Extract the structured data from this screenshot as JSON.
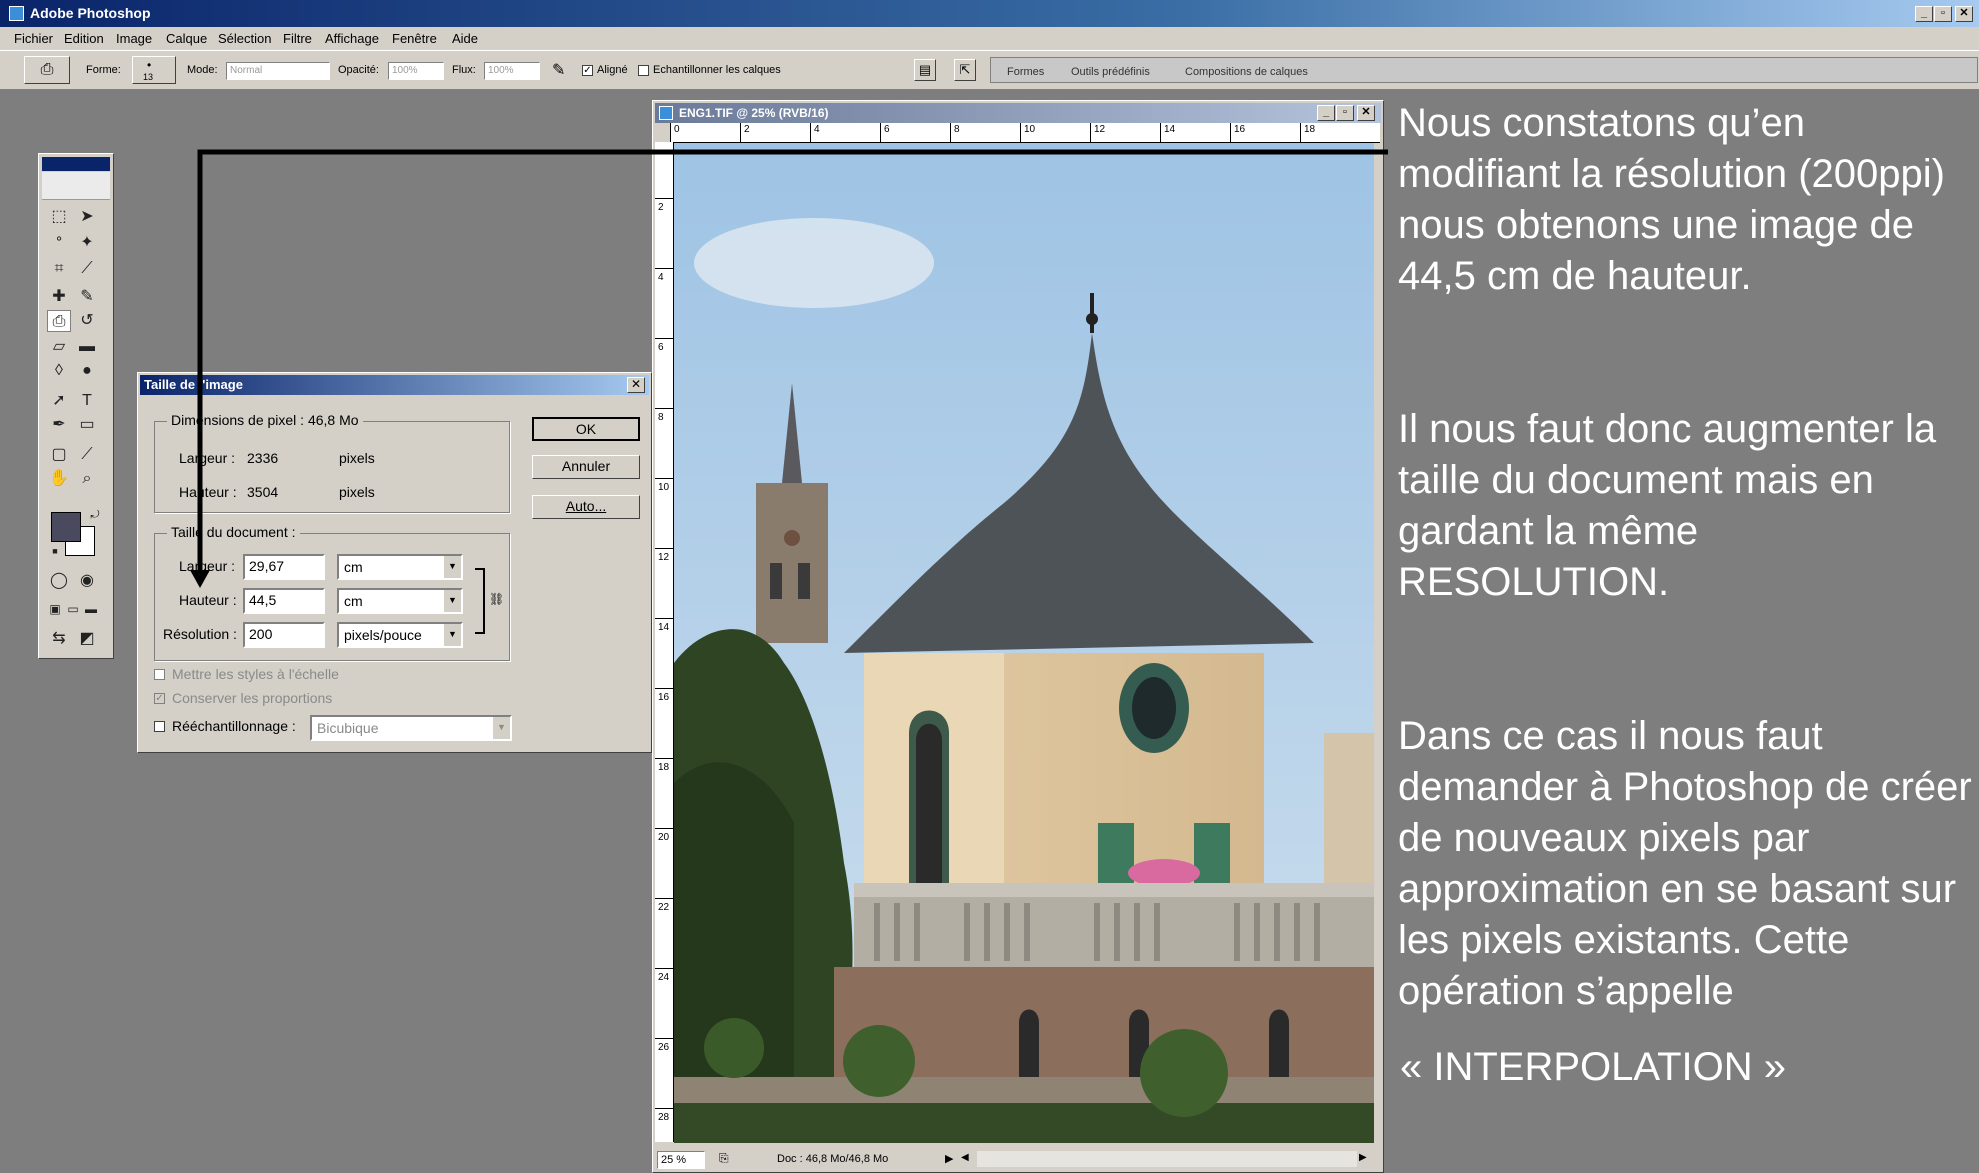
{
  "app": {
    "title": "Adobe Photoshop"
  },
  "menu": {
    "items": [
      "Fichier",
      "Edition",
      "Image",
      "Calque",
      "Sélection",
      "Filtre",
      "Affichage",
      "Fenêtre",
      "Aide"
    ]
  },
  "options": {
    "forme_label": "Forme:",
    "brush_size": "13",
    "mode_label": "Mode:",
    "mode_value": "Normal",
    "opacite_label": "Opacité:",
    "opacite_value": "100%",
    "flux_label": "Flux:",
    "flux_value": "100%",
    "aligne_label": "Aligné",
    "aligne_checked": "✓",
    "echantillonner_label": "Echantillonner les calques",
    "palette_tabs": [
      "Formes",
      "Outils prédéfinis",
      "Compositions de calques"
    ]
  },
  "dialog": {
    "title": "Taille de l'image",
    "close_glyph": "✕",
    "pixel_group_label": "Dimensions de pixel :",
    "pixel_size": "46,8 Mo",
    "pixel_width_label": "Largeur :",
    "pixel_width_value": "2336",
    "pixel_width_unit": "pixels",
    "pixel_height_label": "Hauteur :",
    "pixel_height_value": "3504",
    "pixel_height_unit": "pixels",
    "doc_group_label": "Taille du document :",
    "doc_width_label": "Largeur :",
    "doc_width_value": "29,67",
    "doc_width_unit": "cm",
    "doc_height_label": "Hauteur :",
    "doc_height_value": "44,5",
    "doc_height_unit": "cm",
    "resolution_label": "Résolution :",
    "resolution_value": "200",
    "resolution_unit": "pixels/pouce",
    "ok_label": "OK",
    "cancel_label": "Annuler",
    "auto_label": "Auto...",
    "styles_label": "Mettre les styles à l'échelle",
    "proportions_label": "Conserver les proportions",
    "proportions_checked": "✓",
    "resample_label": "Rééchantillonnage :",
    "resample_value": "Bicubique"
  },
  "image_window": {
    "title": "ENG1.TIF @ 25% (RVB/16)",
    "zoom": "25 %",
    "doc_info": "Doc : 46,8 Mo/46,8 Mo",
    "h_ruler_labels": [
      "0",
      "2",
      "4",
      "6",
      "8",
      "10",
      "12",
      "14",
      "16",
      "18"
    ],
    "v_ruler_labels": [
      "2",
      "4",
      "6",
      "8",
      "10",
      "12",
      "14",
      "16",
      "18",
      "20",
      "22",
      "24",
      "26",
      "28"
    ]
  },
  "slide": {
    "para1": "Nous constatons qu’en modifiant la résolution (200ppi) nous obtenons une image de 44,5 cm de hauteur.",
    "para2": "Il nous faut donc augmenter la taille du document mais en gardant la même RESOLUTION.",
    "para3": "Dans ce cas il nous faut demander à Photoshop de créer de nouveaux pixels par approximation en se basant sur les pixels existants. Cette opération s’appelle",
    "para4": "« INTERPOLATION »"
  },
  "colors": {
    "background": "#7e7e7e",
    "titlebar": "#0a246a",
    "chrome": "#d4d0c8",
    "slide_text": "#ffffff"
  }
}
